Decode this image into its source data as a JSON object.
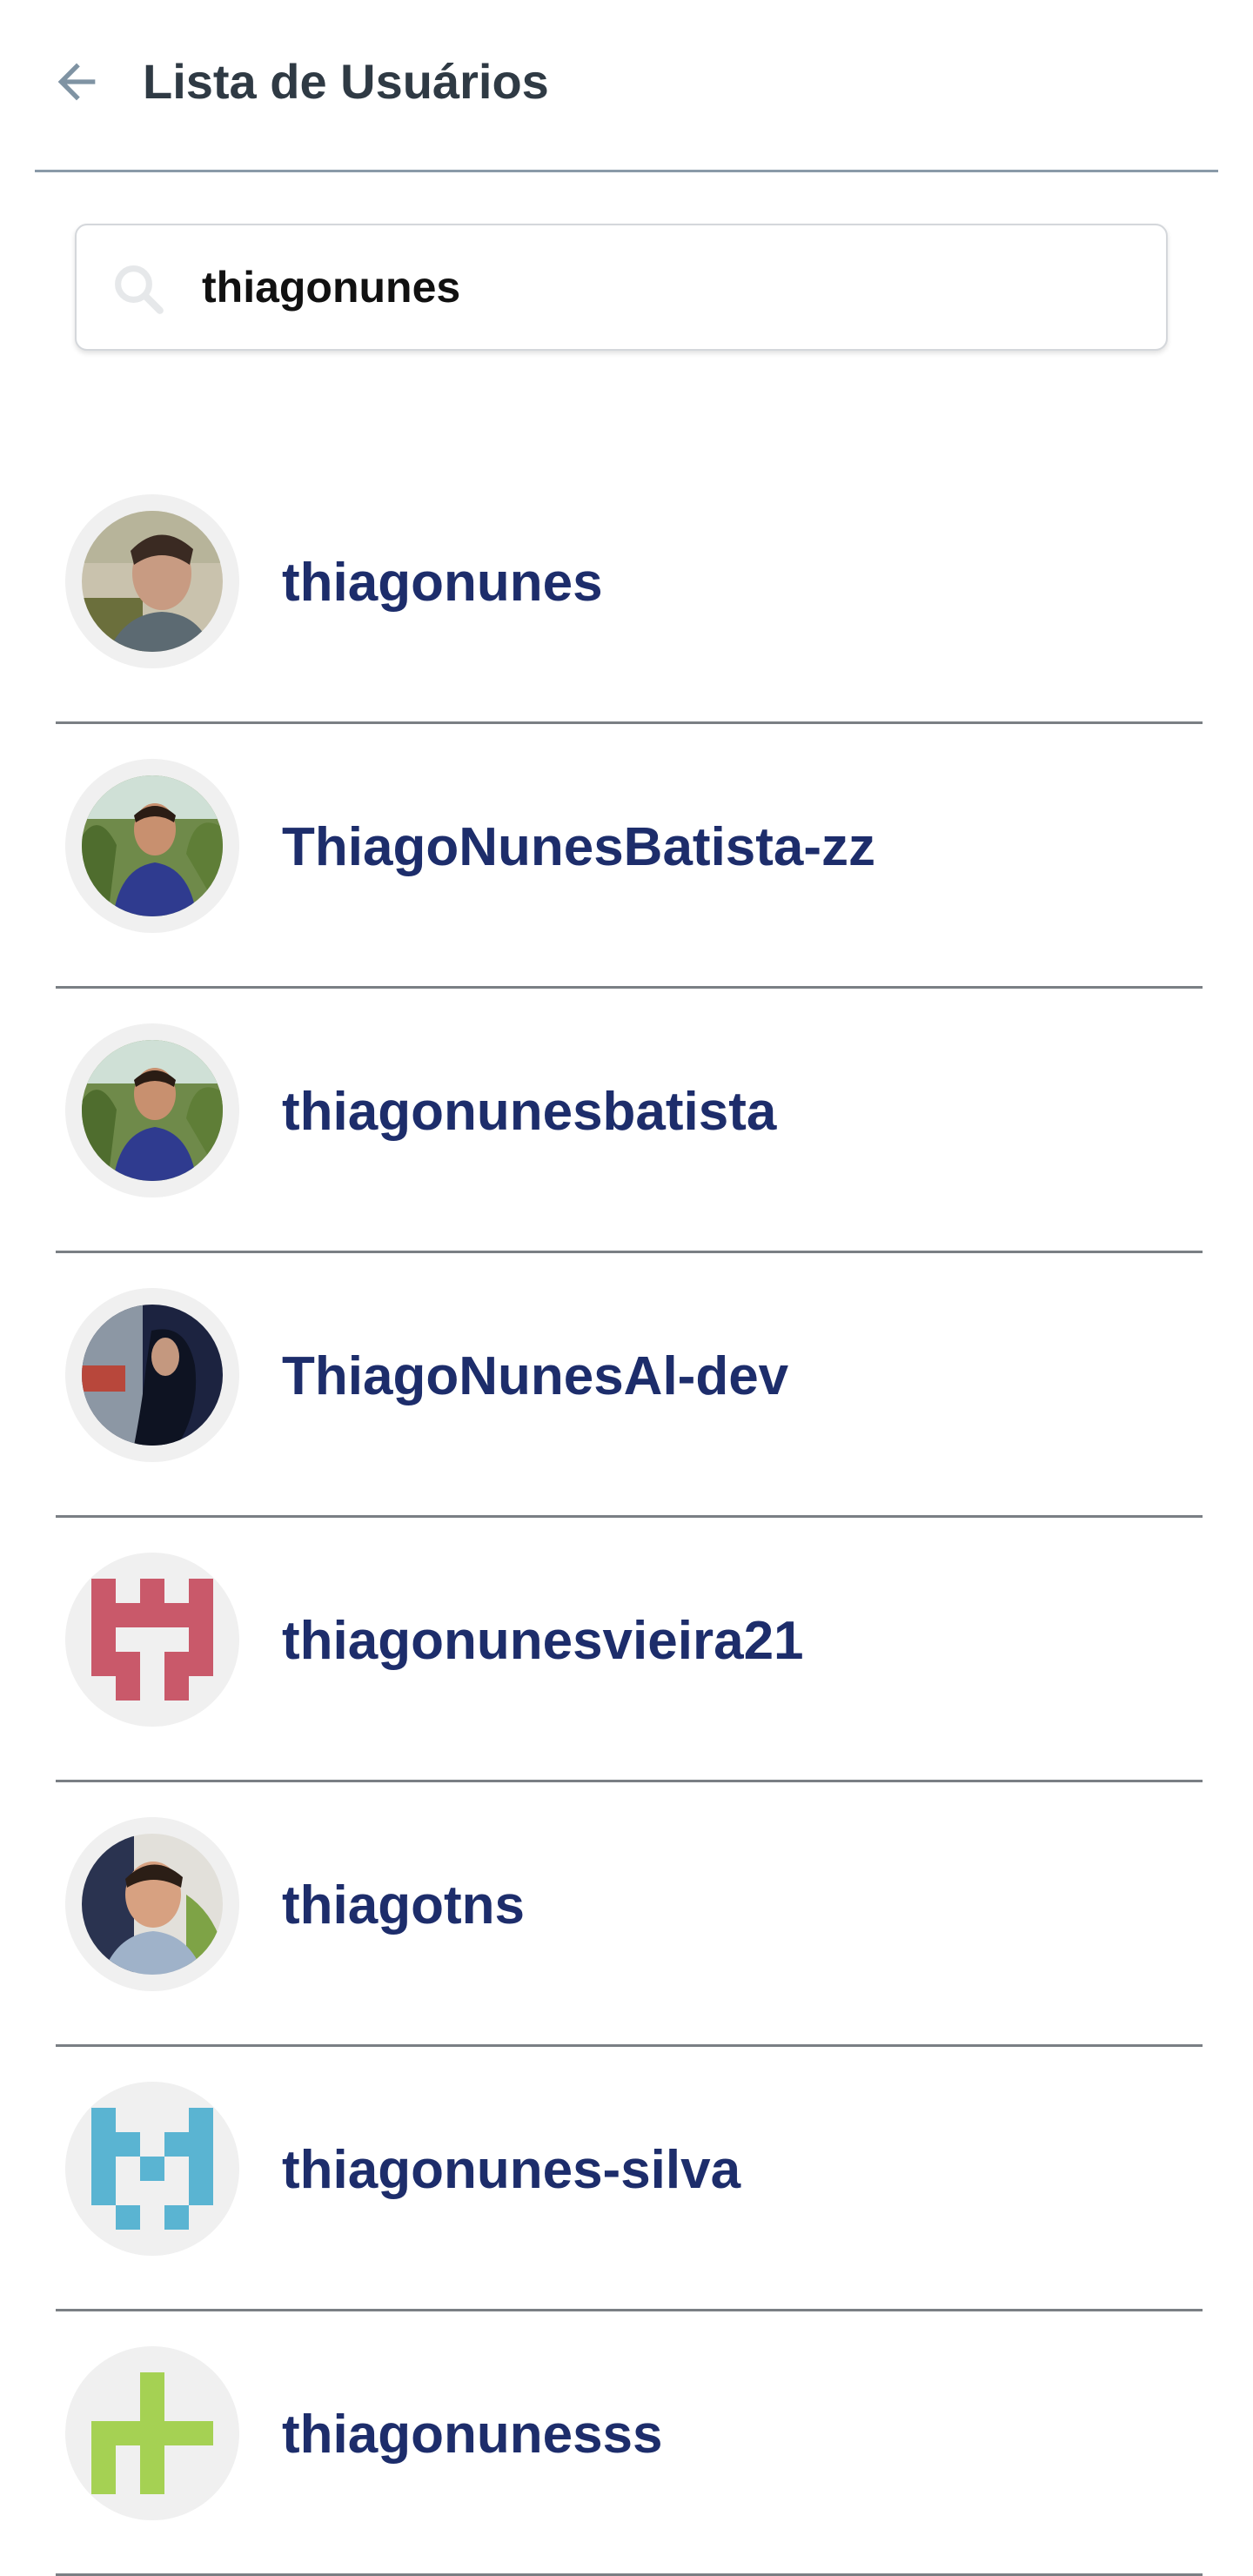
{
  "header": {
    "title": "Lista de Usuários",
    "back_icon": "arrow-left-icon"
  },
  "search": {
    "value": "thiagonunes",
    "icon": "search-icon"
  },
  "colors": {
    "title": "#2f3a44",
    "username": "#1d2d6b",
    "divider": "#7a7f84",
    "header_rule": "#8a9aa8",
    "identicon_red": "#c9596a",
    "identicon_blue": "#5ab4d2",
    "identicon_green": "#a5d153"
  },
  "users": [
    {
      "username": "thiagonunes",
      "avatar": "photo-avatar"
    },
    {
      "username": "ThiagoNunesBatista-zz",
      "avatar": "photo-avatar"
    },
    {
      "username": "thiagonunesbatista",
      "avatar": "photo-avatar"
    },
    {
      "username": "ThiagoNunesAl-dev",
      "avatar": "photo-avatar"
    },
    {
      "username": "thiagonunesvieira21",
      "avatar": "identicon-red"
    },
    {
      "username": "thiagotns",
      "avatar": "photo-avatar"
    },
    {
      "username": "thiagonunes-silva",
      "avatar": "identicon-blue"
    },
    {
      "username": "thiagonunesss",
      "avatar": "identicon-green"
    }
  ]
}
